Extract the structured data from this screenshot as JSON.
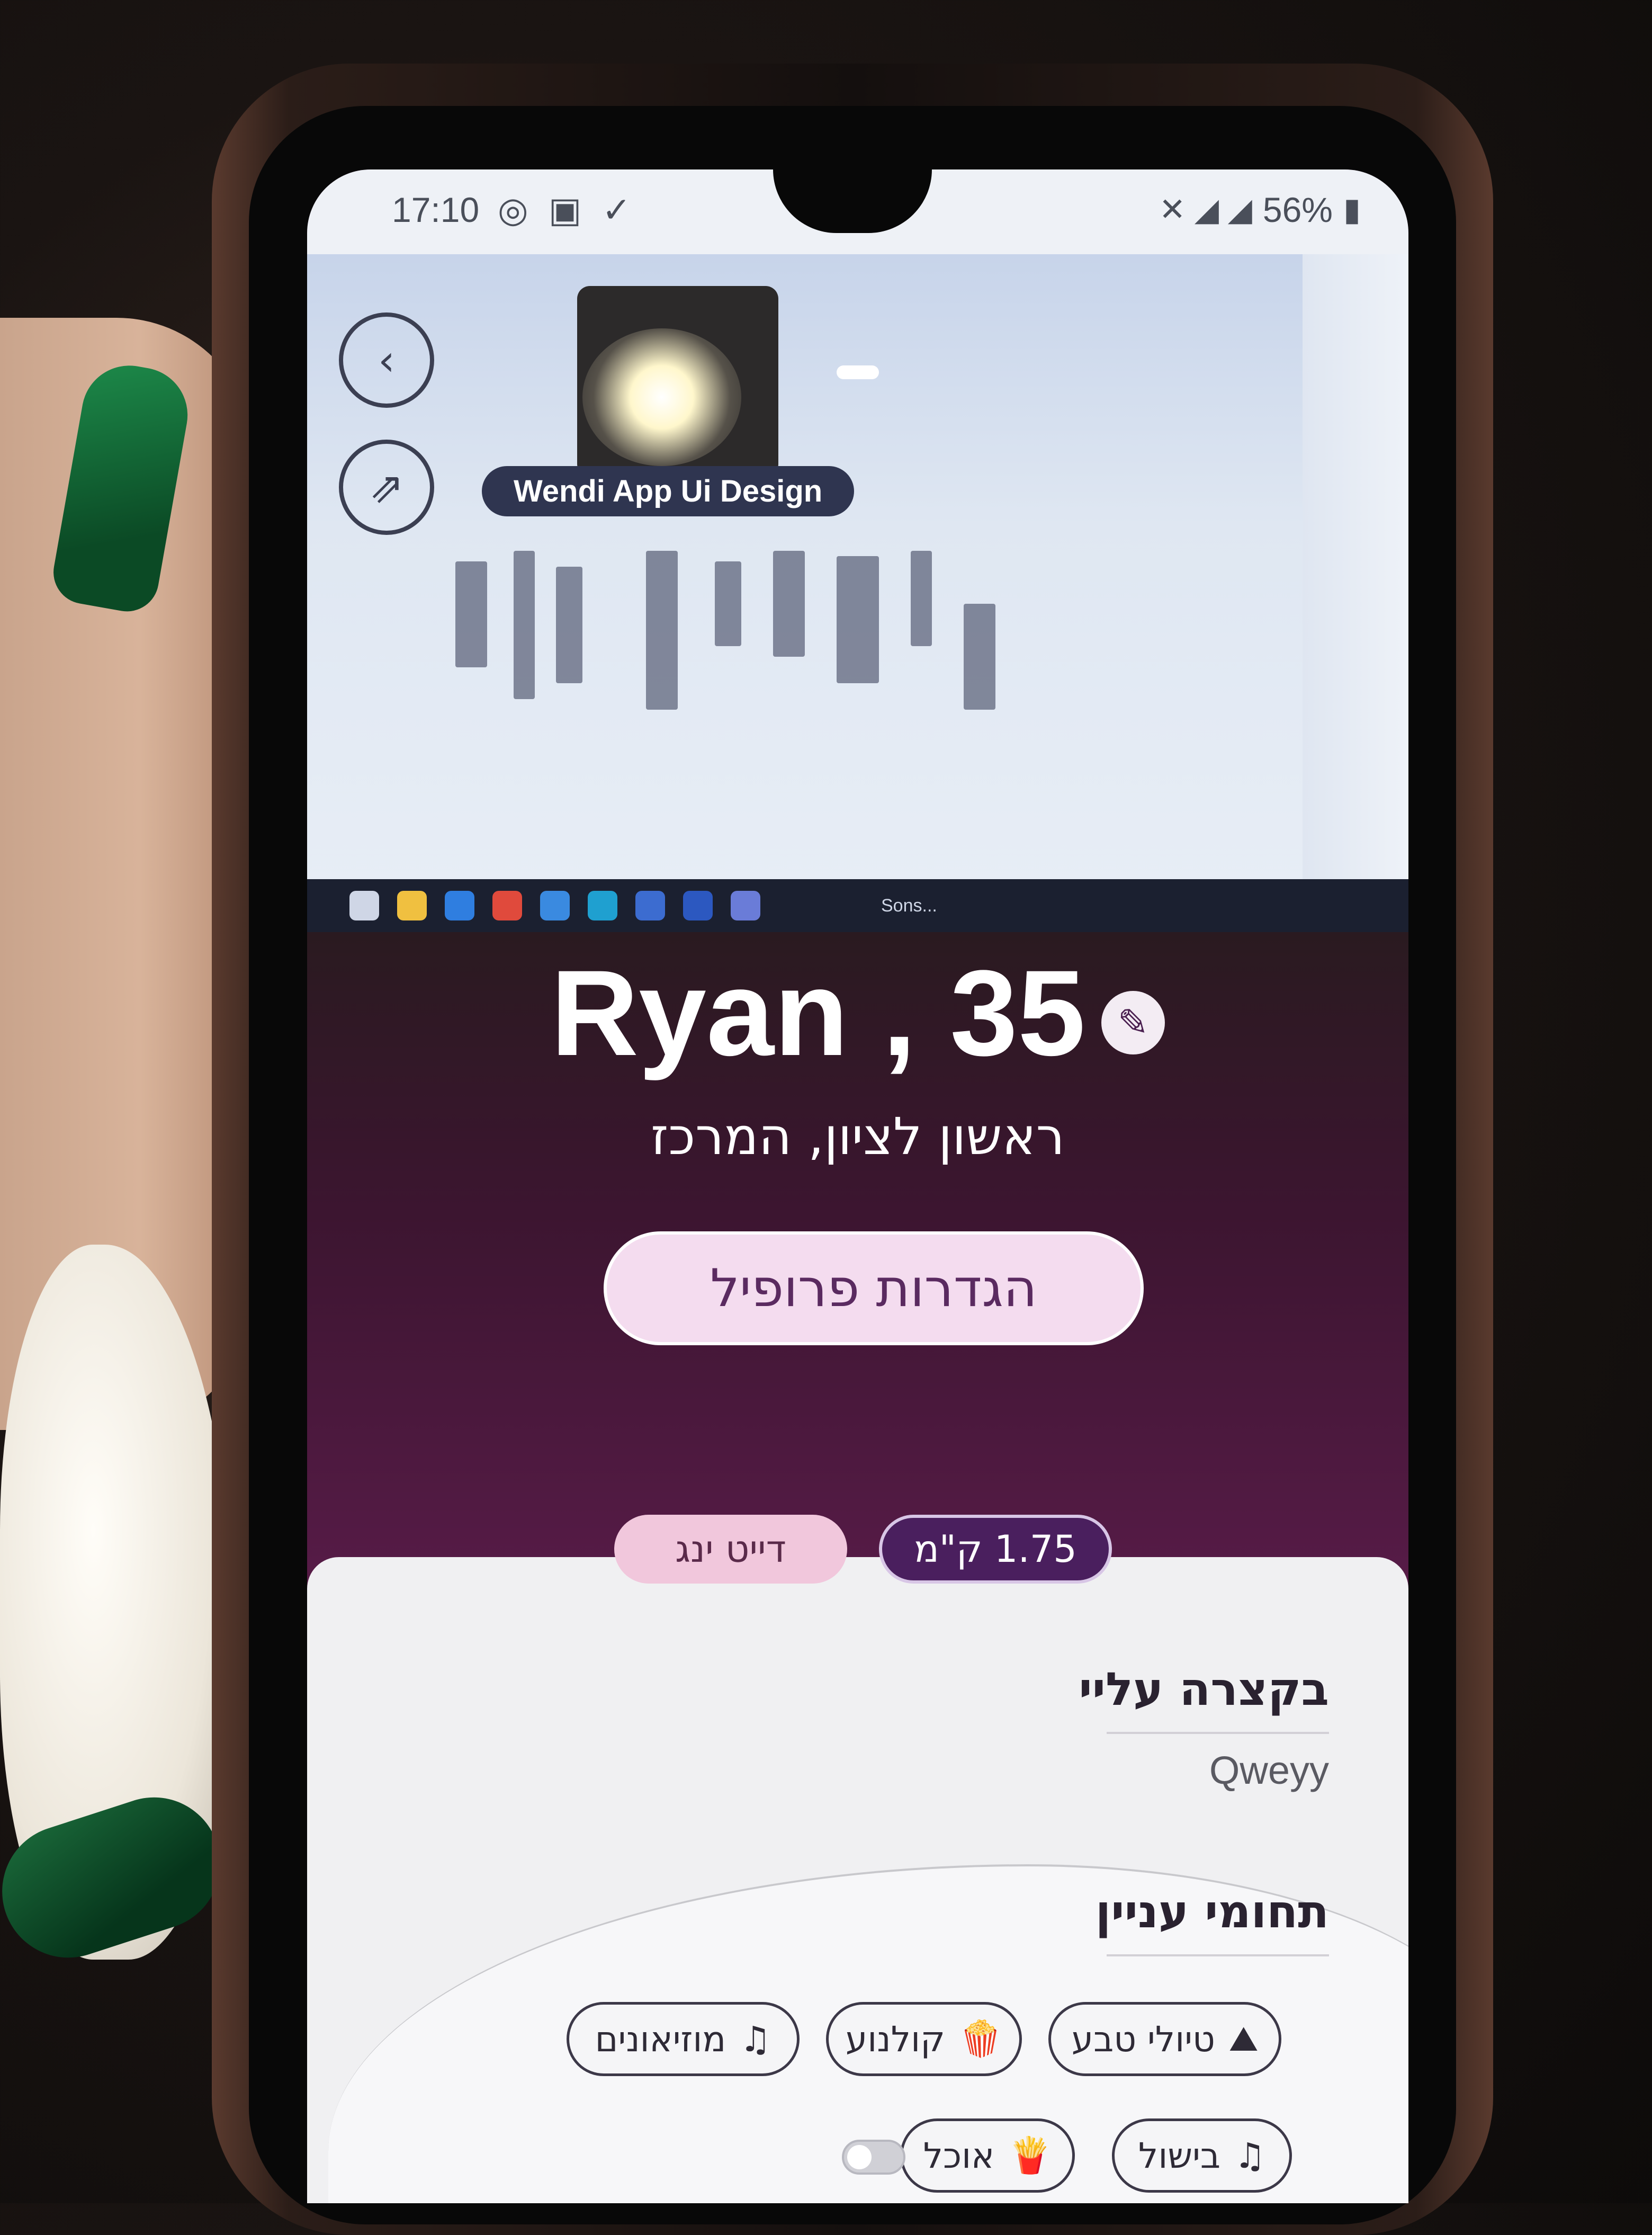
{
  "status_bar": {
    "time": "17:10",
    "left_icons": "◎ ▣ ✓",
    "battery": "56%",
    "right_icons": "✕ ◢ ◢"
  },
  "desktop_screenshot": {
    "design_title": "Wendi App Ui Design",
    "taskbar_weather": "Sons..."
  },
  "profile": {
    "name_age": "Ryan , 35",
    "location": "ראשון לציון, המרכז",
    "settings_button": "הגדרות פרופיל",
    "distance_tag": "1.75 ק\"מ",
    "dating_tag": "דייט ינג"
  },
  "about": {
    "title": "בקצרה עליי",
    "text": "Qweyy"
  },
  "interests": {
    "title": "תחומי עניין",
    "items": [
      {
        "label": "טיולי טבע",
        "icon": "hiking-icon"
      },
      {
        "label": "קולנוע",
        "icon": "popcorn-icon"
      },
      {
        "label": "מוזיאונים",
        "icon": "music-note-icon"
      },
      {
        "label": "בישול",
        "icon": "music-note-icon"
      },
      {
        "label": "אוכל",
        "icon": "fries-icon"
      }
    ]
  },
  "colors": {
    "accent_purple": "#4a1f5e",
    "accent_pink": "#f1c7dc",
    "card_bg": "#f0f0f2"
  }
}
